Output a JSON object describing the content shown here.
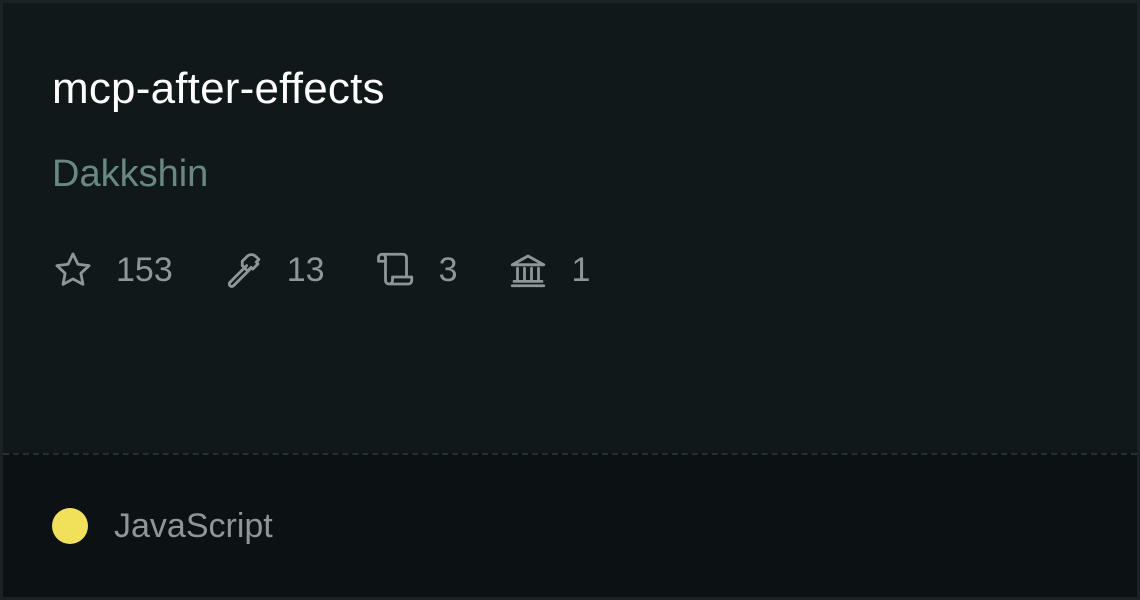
{
  "repo": {
    "name": "mcp-after-effects",
    "owner": "Dakkshin"
  },
  "stats": {
    "stars": "153",
    "tools": "13",
    "scripts": "3",
    "institutions": "1"
  },
  "icons": {
    "stars": "star-icon",
    "tools": "hammer-icon",
    "scripts": "scroll-icon",
    "institutions": "bank-icon"
  },
  "language": {
    "name": "JavaScript",
    "color": "#f1e05a"
  },
  "colors": {
    "title": "#ffffff",
    "owner": "#6a8883",
    "muted": "#8e9698",
    "background": "#10181a",
    "footer_background": "#0c1113"
  }
}
